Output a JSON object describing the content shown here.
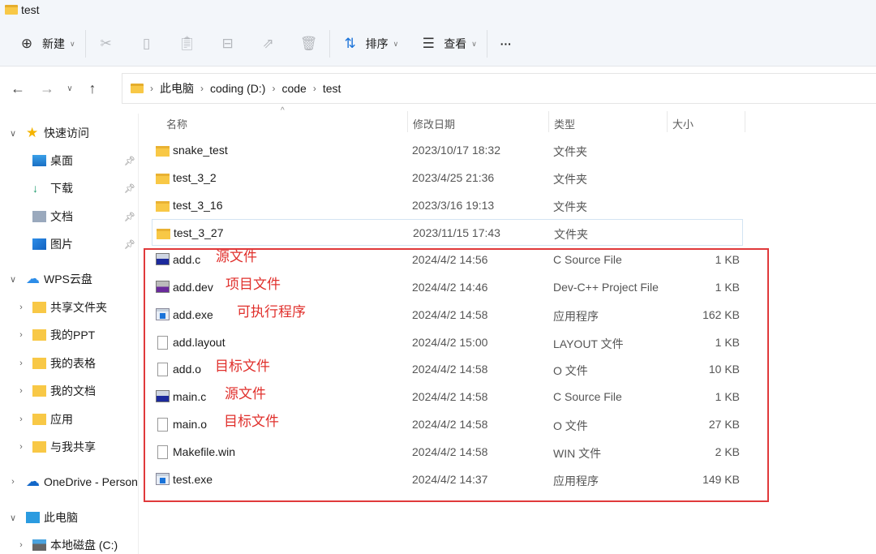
{
  "window": {
    "title": "test"
  },
  "toolbar": {
    "new_label": "新建",
    "sort_label": "排序",
    "view_label": "查看",
    "more_label": "···",
    "icons": [
      "cut-icon",
      "copy-icon",
      "paste-icon",
      "rename-icon",
      "share-icon",
      "delete-icon"
    ]
  },
  "address": {
    "crumbs": [
      "此电脑",
      "coding (D:)",
      "code",
      "test"
    ]
  },
  "sidebar": {
    "items": [
      {
        "label": "快速访问",
        "icon": "star-icon",
        "level": 0,
        "expand": "v"
      },
      {
        "label": "桌面",
        "icon": "desktop-icon",
        "level": 1,
        "pinned": true
      },
      {
        "label": "下载",
        "icon": "download-icon",
        "level": 1,
        "pinned": true
      },
      {
        "label": "文档",
        "icon": "document-icon",
        "level": 1,
        "pinned": true
      },
      {
        "label": "图片",
        "icon": "picture-icon",
        "level": 1,
        "pinned": true
      },
      {
        "label": "WPS云盘",
        "icon": "cloud-icon",
        "level": 0,
        "expand": "v"
      },
      {
        "label": "共享文件夹",
        "icon": "folder-icon",
        "level": 1,
        "expand": ">"
      },
      {
        "label": "我的PPT",
        "icon": "folder-icon",
        "level": 1,
        "expand": ">"
      },
      {
        "label": "我的表格",
        "icon": "folder-icon",
        "level": 1,
        "expand": ">"
      },
      {
        "label": "我的文档",
        "icon": "folder-icon",
        "level": 1,
        "expand": ">"
      },
      {
        "label": "应用",
        "icon": "folder-icon",
        "level": 1,
        "expand": ">"
      },
      {
        "label": "与我共享",
        "icon": "folder-icon",
        "level": 1,
        "expand": ">"
      },
      {
        "label": "OneDrive - Personal",
        "icon": "onedrive-icon",
        "level": 0,
        "expand": ">"
      },
      {
        "label": "此电脑",
        "icon": "computer-icon",
        "level": 0,
        "expand": "v"
      },
      {
        "label": "本地磁盘 (C:)",
        "icon": "drive-icon",
        "level": 1,
        "expand": ">"
      }
    ]
  },
  "columns": {
    "name": "名称",
    "date": "修改日期",
    "type": "类型",
    "size": "大小"
  },
  "files": [
    {
      "name": "snake_test",
      "date": "2023/10/17 18:32",
      "type": "文件夹",
      "size": "",
      "icon": "folder"
    },
    {
      "name": "test_3_2",
      "date": "2023/4/25 21:36",
      "type": "文件夹",
      "size": "",
      "icon": "folder"
    },
    {
      "name": "test_3_16",
      "date": "2023/3/16 19:13",
      "type": "文件夹",
      "size": "",
      "icon": "folder"
    },
    {
      "name": "test_3_27",
      "date": "2023/11/15 17:43",
      "type": "文件夹",
      "size": "",
      "icon": "folder",
      "selected": true
    },
    {
      "name": "add.c",
      "date": "2024/4/2 14:56",
      "type": "C Source File",
      "size": "1 KB",
      "icon": "csource"
    },
    {
      "name": "add.dev",
      "date": "2024/4/2 14:46",
      "type": "Dev-C++ Project File",
      "size": "1 KB",
      "icon": "dev"
    },
    {
      "name": "add.exe",
      "date": "2024/4/2 14:58",
      "type": "应用程序",
      "size": "162 KB",
      "icon": "exe"
    },
    {
      "name": "add.layout",
      "date": "2024/4/2 15:00",
      "type": "LAYOUT 文件",
      "size": "1 KB",
      "icon": "file"
    },
    {
      "name": "add.o",
      "date": "2024/4/2 14:58",
      "type": "O 文件",
      "size": "10 KB",
      "icon": "file"
    },
    {
      "name": "main.c",
      "date": "2024/4/2 14:58",
      "type": "C Source File",
      "size": "1 KB",
      "icon": "csource"
    },
    {
      "name": "main.o",
      "date": "2024/4/2 14:58",
      "type": "O 文件",
      "size": "27 KB",
      "icon": "file"
    },
    {
      "name": "Makefile.win",
      "date": "2024/4/2 14:58",
      "type": "WIN 文件",
      "size": "2 KB",
      "icon": "file"
    },
    {
      "name": "test.exe",
      "date": "2024/4/2 14:37",
      "type": "应用程序",
      "size": "149 KB",
      "icon": "exe"
    }
  ],
  "annotations": [
    {
      "text": "源文件",
      "row": 4
    },
    {
      "text": "项目文件",
      "row": 5
    },
    {
      "text": "可执行程序",
      "row": 6
    },
    {
      "text": "目标文件",
      "row": 8
    },
    {
      "text": "源文件",
      "row": 9
    },
    {
      "text": "目标文件",
      "row": 10
    }
  ],
  "colors": {
    "annotation": "#e0302c",
    "folder": "#f8c846",
    "accent": "#1a73d9"
  }
}
